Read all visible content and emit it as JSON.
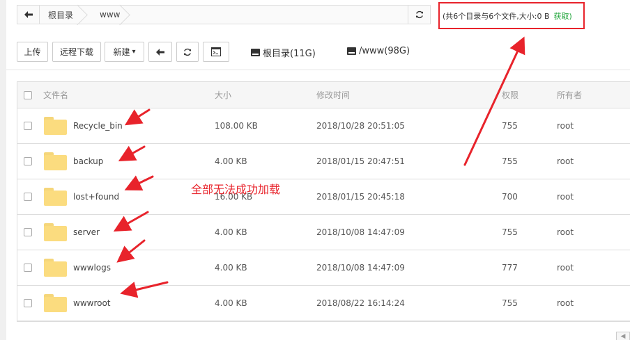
{
  "path_bar": {
    "crumbs": [
      "根目录",
      "www"
    ]
  },
  "summary": {
    "text": "(共6个目录与6个文件,大小:0 B",
    "get_link": "获取)"
  },
  "toolbar": {
    "upload": "上传",
    "remote_download": "远程下载",
    "new": "新建",
    "new_caret": "▾",
    "disks": [
      {
        "label": "根目录(11G)"
      },
      {
        "label": "/www(98G)"
      }
    ]
  },
  "table": {
    "headers": {
      "name": "文件名",
      "size": "大小",
      "modified": "修改时间",
      "perm": "权限",
      "owner": "所有者"
    },
    "rows": [
      {
        "name": "Recycle_bin",
        "size": "108.00 KB",
        "modified": "2018/10/28 20:51:05",
        "perm": "755",
        "owner": "root"
      },
      {
        "name": "backup",
        "size": "4.00 KB",
        "modified": "2018/01/15 20:47:51",
        "perm": "755",
        "owner": "root"
      },
      {
        "name": "lost+found",
        "size": "16.00 KB",
        "modified": "2018/01/15 20:45:18",
        "perm": "700",
        "owner": "root"
      },
      {
        "name": "server",
        "size": "4.00 KB",
        "modified": "2018/10/08 14:47:09",
        "perm": "755",
        "owner": "root"
      },
      {
        "name": "wwwlogs",
        "size": "4.00 KB",
        "modified": "2018/10/08 14:47:09",
        "perm": "777",
        "owner": "root"
      },
      {
        "name": "wwwroot",
        "size": "4.00 KB",
        "modified": "2018/08/22 16:14:24",
        "perm": "755",
        "owner": "root"
      }
    ]
  },
  "annotation": {
    "text": "全部无法成功加载",
    "color": "#e8232b"
  },
  "colors": {
    "accent_green": "#20a53a",
    "highlight_red": "#e8232b",
    "folder_yellow": "#fbdc7f"
  },
  "icons": [
    "back-arrow-icon",
    "refresh-icon",
    "terminal-icon",
    "disk-icon",
    "folder-icon",
    "chevron-down-icon"
  ]
}
